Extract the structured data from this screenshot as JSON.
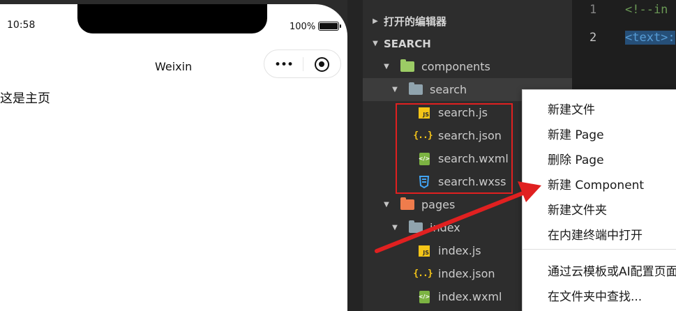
{
  "phone": {
    "time": "10:58",
    "battery_text": "100%",
    "battery_level": 1.0,
    "nav_title": "Weixin",
    "capsule_dots": "•••",
    "page_text": "这是主页"
  },
  "explorer": {
    "open_editors": "打开的编辑器",
    "section": "SEARCH",
    "tree": {
      "components": "components",
      "search": "search",
      "search_js": "search.js",
      "search_json": "search.json",
      "search_wxml": "search.wxml",
      "search_wxss": "search.wxss",
      "pages": "pages",
      "index": "index",
      "index_js": "index.js",
      "index_json": "index.json",
      "index_wxml": "index.wxml"
    }
  },
  "editor": {
    "line1_no": "1",
    "line2_no": "2",
    "line1_text": "<!--in",
    "line2_text": "<text>:"
  },
  "context_menu": {
    "items": [
      "新建文件",
      "新建 Page",
      "删除 Page",
      "新建 Component",
      "新建文件夹",
      "在内建终端中打开",
      "通过云模板或AI配置页面",
      "在文件夹中查找..."
    ]
  },
  "colors": {
    "annotation_red": "#e02020",
    "explorer_bg": "#2d2d2d",
    "editor_bg": "#1e1e1e",
    "folder_components": "#9ccc65",
    "folder_pages": "#ef7c4c",
    "folder_plain": "#90a4ae",
    "js_yellow": "#f5c518",
    "wxml_green": "#7cb342",
    "wxss_blue": "#42a5f5"
  }
}
